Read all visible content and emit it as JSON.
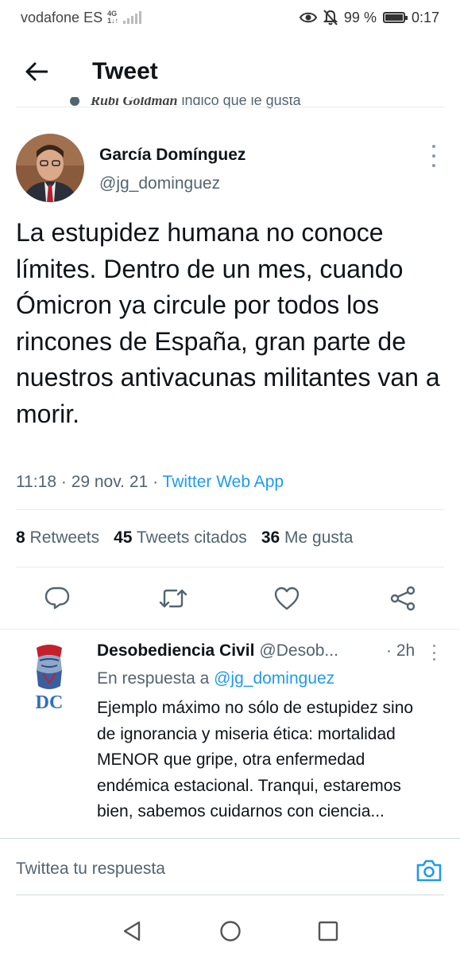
{
  "status_bar": {
    "carrier": "vodafone ES",
    "network_top": "4G",
    "network_bottom": "1↓↑",
    "battery_percent": "99 %",
    "battery_level": 0.99,
    "time": "0:17"
  },
  "header": {
    "title": "Tweet",
    "back_icon": "arrow-left-icon"
  },
  "liked_by": {
    "name": "Rubi Goldman",
    "text": "indicó que le gusta"
  },
  "tweet": {
    "author_name": "García Domínguez",
    "author_handle": "@jg_dominguez",
    "text": "La estupidez humana no conoce límites. Dentro de un mes, cuando Ómicron ya circule por todos los rincones de España, gran parte de nuestros antivacunas militantes van a morir.",
    "time": "11:18",
    "date": "29 nov. 21",
    "separator": "·",
    "source": "Twitter Web App",
    "retweets_count": "8",
    "retweets_label": "Retweets",
    "quotes_count": "45",
    "quotes_label": "Tweets citados",
    "likes_count": "36",
    "likes_label": "Me gusta",
    "colors": {
      "accent": "#1d9bf0",
      "text": "#0f1419",
      "secondary": "#536471"
    }
  },
  "reply": {
    "author_name": "Desobediencia Civil",
    "author_handle": "@Desob...",
    "time": "· 2h",
    "reply_prefix": "En respuesta a",
    "reply_mention": "@jg_dominguez",
    "avatar_text": "DC",
    "text": "Ejemplo máximo no sólo de estupidez sino de ignorancia y miseria ética: mortalidad MENOR que gripe, otra enfermedad endémica estacional. Tranqui, estaremos bien, sabemos cuidarnos con ciencia..."
  },
  "compose": {
    "placeholder": "Twittea tu respuesta",
    "camera_icon": "camera-icon"
  },
  "system_nav": [
    "back-triangle-icon",
    "home-circle-icon",
    "recents-square-icon"
  ]
}
